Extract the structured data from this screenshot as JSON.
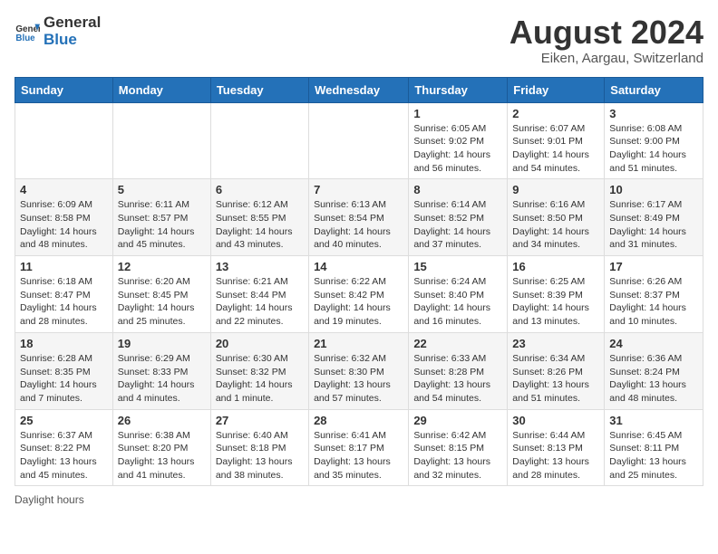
{
  "logo": {
    "text_general": "General",
    "text_blue": "Blue"
  },
  "title": "August 2024",
  "subtitle": "Eiken, Aargau, Switzerland",
  "days_of_week": [
    "Sunday",
    "Monday",
    "Tuesday",
    "Wednesday",
    "Thursday",
    "Friday",
    "Saturday"
  ],
  "footer": "Daylight hours",
  "weeks": [
    [
      {
        "day": "",
        "info": ""
      },
      {
        "day": "",
        "info": ""
      },
      {
        "day": "",
        "info": ""
      },
      {
        "day": "",
        "info": ""
      },
      {
        "day": "1",
        "info": "Sunrise: 6:05 AM\nSunset: 9:02 PM\nDaylight: 14 hours\nand 56 minutes."
      },
      {
        "day": "2",
        "info": "Sunrise: 6:07 AM\nSunset: 9:01 PM\nDaylight: 14 hours\nand 54 minutes."
      },
      {
        "day": "3",
        "info": "Sunrise: 6:08 AM\nSunset: 9:00 PM\nDaylight: 14 hours\nand 51 minutes."
      }
    ],
    [
      {
        "day": "4",
        "info": "Sunrise: 6:09 AM\nSunset: 8:58 PM\nDaylight: 14 hours\nand 48 minutes."
      },
      {
        "day": "5",
        "info": "Sunrise: 6:11 AM\nSunset: 8:57 PM\nDaylight: 14 hours\nand 45 minutes."
      },
      {
        "day": "6",
        "info": "Sunrise: 6:12 AM\nSunset: 8:55 PM\nDaylight: 14 hours\nand 43 minutes."
      },
      {
        "day": "7",
        "info": "Sunrise: 6:13 AM\nSunset: 8:54 PM\nDaylight: 14 hours\nand 40 minutes."
      },
      {
        "day": "8",
        "info": "Sunrise: 6:14 AM\nSunset: 8:52 PM\nDaylight: 14 hours\nand 37 minutes."
      },
      {
        "day": "9",
        "info": "Sunrise: 6:16 AM\nSunset: 8:50 PM\nDaylight: 14 hours\nand 34 minutes."
      },
      {
        "day": "10",
        "info": "Sunrise: 6:17 AM\nSunset: 8:49 PM\nDaylight: 14 hours\nand 31 minutes."
      }
    ],
    [
      {
        "day": "11",
        "info": "Sunrise: 6:18 AM\nSunset: 8:47 PM\nDaylight: 14 hours\nand 28 minutes."
      },
      {
        "day": "12",
        "info": "Sunrise: 6:20 AM\nSunset: 8:45 PM\nDaylight: 14 hours\nand 25 minutes."
      },
      {
        "day": "13",
        "info": "Sunrise: 6:21 AM\nSunset: 8:44 PM\nDaylight: 14 hours\nand 22 minutes."
      },
      {
        "day": "14",
        "info": "Sunrise: 6:22 AM\nSunset: 8:42 PM\nDaylight: 14 hours\nand 19 minutes."
      },
      {
        "day": "15",
        "info": "Sunrise: 6:24 AM\nSunset: 8:40 PM\nDaylight: 14 hours\nand 16 minutes."
      },
      {
        "day": "16",
        "info": "Sunrise: 6:25 AM\nSunset: 8:39 PM\nDaylight: 14 hours\nand 13 minutes."
      },
      {
        "day": "17",
        "info": "Sunrise: 6:26 AM\nSunset: 8:37 PM\nDaylight: 14 hours\nand 10 minutes."
      }
    ],
    [
      {
        "day": "18",
        "info": "Sunrise: 6:28 AM\nSunset: 8:35 PM\nDaylight: 14 hours\nand 7 minutes."
      },
      {
        "day": "19",
        "info": "Sunrise: 6:29 AM\nSunset: 8:33 PM\nDaylight: 14 hours\nand 4 minutes."
      },
      {
        "day": "20",
        "info": "Sunrise: 6:30 AM\nSunset: 8:32 PM\nDaylight: 14 hours\nand 1 minute."
      },
      {
        "day": "21",
        "info": "Sunrise: 6:32 AM\nSunset: 8:30 PM\nDaylight: 13 hours\nand 57 minutes."
      },
      {
        "day": "22",
        "info": "Sunrise: 6:33 AM\nSunset: 8:28 PM\nDaylight: 13 hours\nand 54 minutes."
      },
      {
        "day": "23",
        "info": "Sunrise: 6:34 AM\nSunset: 8:26 PM\nDaylight: 13 hours\nand 51 minutes."
      },
      {
        "day": "24",
        "info": "Sunrise: 6:36 AM\nSunset: 8:24 PM\nDaylight: 13 hours\nand 48 minutes."
      }
    ],
    [
      {
        "day": "25",
        "info": "Sunrise: 6:37 AM\nSunset: 8:22 PM\nDaylight: 13 hours\nand 45 minutes."
      },
      {
        "day": "26",
        "info": "Sunrise: 6:38 AM\nSunset: 8:20 PM\nDaylight: 13 hours\nand 41 minutes."
      },
      {
        "day": "27",
        "info": "Sunrise: 6:40 AM\nSunset: 8:18 PM\nDaylight: 13 hours\nand 38 minutes."
      },
      {
        "day": "28",
        "info": "Sunrise: 6:41 AM\nSunset: 8:17 PM\nDaylight: 13 hours\nand 35 minutes."
      },
      {
        "day": "29",
        "info": "Sunrise: 6:42 AM\nSunset: 8:15 PM\nDaylight: 13 hours\nand 32 minutes."
      },
      {
        "day": "30",
        "info": "Sunrise: 6:44 AM\nSunset: 8:13 PM\nDaylight: 13 hours\nand 28 minutes."
      },
      {
        "day": "31",
        "info": "Sunrise: 6:45 AM\nSunset: 8:11 PM\nDaylight: 13 hours\nand 25 minutes."
      }
    ]
  ]
}
